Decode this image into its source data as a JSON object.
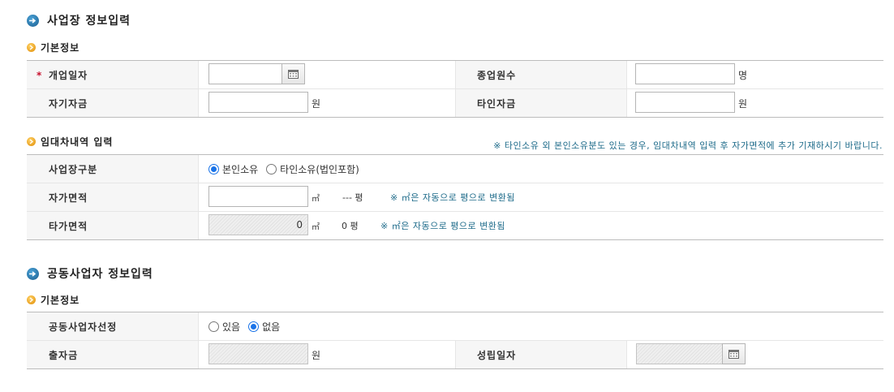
{
  "section1": {
    "title": "사업장 정보입력",
    "basic_title": "기본정보",
    "fields": {
      "open_date_label": "개업일자",
      "required_mark": "*",
      "employees_label": "종업원수",
      "employees_unit": "명",
      "own_capital_label": "자기자금",
      "own_capital_unit": "원",
      "other_capital_label": "타인자금",
      "other_capital_unit": "원"
    },
    "lease_title": "임대차내역 입력",
    "lease_notice": "※ 타인소유 외 본인소유분도 있는 경우, 임대차내역 입력 후 자가면적에 추가 기재하시기 바랍니다.",
    "lease": {
      "type_label": "사업장구분",
      "type_options": [
        "본인소유",
        "타인소유(법인포함)"
      ],
      "type_selected": "본인소유",
      "own_area_label": "자가면적",
      "own_area_unit": "㎡",
      "own_area_pyeong": "--- 평",
      "auto_convert_hint": "※ ㎡은 자동으로 평으로 변환됨",
      "other_area_label": "타가면적",
      "other_area_value": "0",
      "other_area_unit": "㎡",
      "other_area_pyeong": "0 평"
    }
  },
  "section2": {
    "title": "공동사업자 정보입력",
    "basic_title": "기본정보",
    "fields": {
      "joint_select_label": "공동사업자선정",
      "joint_options": [
        "있음",
        "없음"
      ],
      "joint_selected": "없음",
      "investment_label": "출자금",
      "investment_unit": "원",
      "established_date_label": "성립일자"
    }
  },
  "colors": {
    "accent_blue": "#1b5e8f",
    "notice_teal": "#1e6b8a",
    "required_red": "#c8102e",
    "radio_blue": "#1a73e8"
  }
}
